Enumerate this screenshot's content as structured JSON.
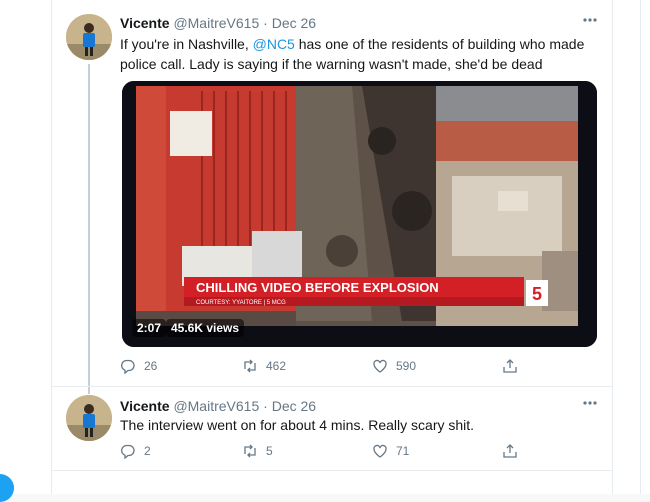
{
  "tweets": [
    {
      "author_name": "Vicente",
      "handle": "@MaitreV615",
      "separator": "·",
      "date": "Dec 26",
      "text_before": "If you're in Nashville, ",
      "mention": "@NC5",
      "text_after": " has one of the residents of building who made police call. Lady is saying if the warning wasn't made, she'd be dead",
      "video": {
        "banner_title": "CHILLING VIDEO BEFORE EXPLOSION",
        "banner_sub": "COURTESY: YYAITORE | 5 MCG",
        "duration": "2:07",
        "views": "45.6K views"
      },
      "stats": {
        "replies": "26",
        "retweets": "462",
        "likes": "590"
      }
    },
    {
      "author_name": "Vicente",
      "handle": "@MaitreV615",
      "separator": "·",
      "date": "Dec 26",
      "text": "The interview went on for about 4 mins. Really scary shit.",
      "stats": {
        "replies": "2",
        "retweets": "5",
        "likes": "71"
      }
    }
  ],
  "icons": {
    "more": "more-horizontal-icon",
    "reply": "reply-icon",
    "retweet": "retweet-icon",
    "like": "heart-icon",
    "share": "share-icon"
  },
  "colors": {
    "accent": "#1da1f2",
    "mention": "#1b95e0",
    "muted": "#657786",
    "text": "#14171a",
    "banner": "#d32027"
  }
}
